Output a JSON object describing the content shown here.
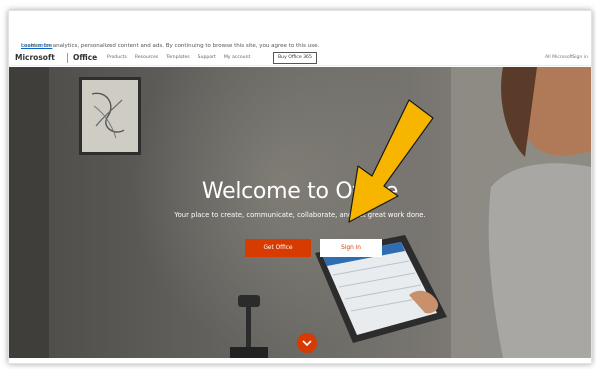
{
  "cookie_banner": {
    "text": "cookies for analytics, personalized content and ads. By continuing to browse this site, you agree to this use.",
    "link": "Learn more"
  },
  "nav": {
    "brand": "Microsoft",
    "product": "Office",
    "items": [
      "Products",
      "Resources",
      "Templates",
      "Support",
      "My account"
    ],
    "buy_label": "Buy Office 365",
    "right_label": "All Microsoft",
    "right_label_2": "Sign in"
  },
  "hero": {
    "title": "Welcome to Office",
    "subtitle": "Your place to create, communicate, collaborate, and get great work done.",
    "get_office_label": "Get Office",
    "sign_in_label": "Sign in"
  },
  "colors": {
    "accent": "#d83b01",
    "annotation_arrow": "#f7b500"
  },
  "icons": {
    "scroll": "chevron-down-icon",
    "annotation": "arrow-icon"
  }
}
